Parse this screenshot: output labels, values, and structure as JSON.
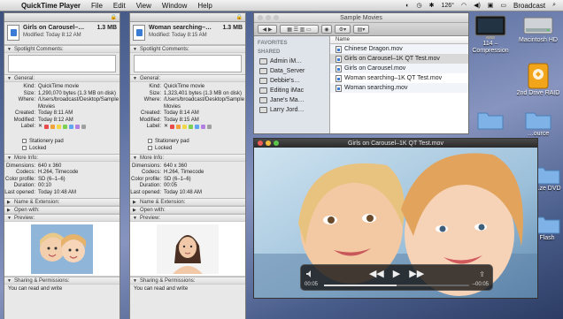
{
  "menubar": {
    "app_name": "QuickTime Player",
    "items": [
      "File",
      "Edit",
      "View",
      "Window",
      "Help"
    ],
    "temperature": "126°",
    "user": "Broadcast"
  },
  "info_windows": [
    {
      "title": "Girls on Carousel–…",
      "size": "1.3 MB",
      "modified": "Modified: Today 8:12 AM",
      "spotlight": "Spotlight Comments:",
      "general": "General:",
      "kind": "QuickTime movie",
      "size_detail": "1,290,070 bytes (1.3 MB on disk)",
      "where": "/Users/broadcast/Desktop/Sample Movies",
      "created": "Today 8:11 AM",
      "modified_detail": "Today 8:12 AM",
      "label": "Label:",
      "stationery": "Stationery pad",
      "locked": "Locked",
      "more_info": "More Info:",
      "dimensions": "640 x 360",
      "codecs": "H.264, Timecode",
      "color_profile": "SD (6–1–6)",
      "duration": "00:10",
      "last_opened": "Today 10:48 AM",
      "name_ext": "Name & Extension:",
      "open_with": "Open with:",
      "preview": "Preview:",
      "sharing": "Sharing & Permissions:",
      "sharing_text": "You can read and write"
    },
    {
      "title": "Woman searching–…",
      "size": "1.3 MB",
      "modified": "Modified: Today 8:15 AM",
      "spotlight": "Spotlight Comments:",
      "general": "General:",
      "kind": "QuickTime movie",
      "size_detail": "1,323,401 bytes (1.3 MB on disk)",
      "where": "/Users/broadcast/Desktop/Sample Movies",
      "created": "Today 8:14 AM",
      "modified_detail": "Today 8:15 AM",
      "label": "Label:",
      "stationery": "Stationery pad",
      "locked": "Locked",
      "more_info": "More Info:",
      "dimensions": "640 x 360",
      "codecs": "H.264, Timecode",
      "color_profile": "SD (6–1–6)",
      "duration": "00:05",
      "last_opened": "Today 10:48 AM",
      "name_ext": "Name & Extension:",
      "open_with": "Open with:",
      "preview": "Preview:",
      "sharing": "Sharing & Permissions:",
      "sharing_text": "You can read and write"
    }
  ],
  "kv_labels": {
    "kind": "Kind:",
    "size": "Size:",
    "where": "Where:",
    "created": "Created:",
    "modified": "Modified:",
    "dimensions": "Dimensions:",
    "codecs": "Codecs:",
    "color_profile": "Color profile:",
    "duration": "Duration:",
    "last_opened": "Last opened:"
  },
  "label_colors": [
    "#e94b4b",
    "#f2a23a",
    "#f1d84b",
    "#7ccf53",
    "#5fa5ef",
    "#b281e0",
    "#a0a0a0"
  ],
  "finder": {
    "title": "Sample Movies",
    "favorites_header": "FAVORITES",
    "shared_header": "SHARED",
    "shared_items": [
      "Admin iM…",
      "Data_Server",
      "Debbie's…",
      "Editing iMac",
      "Jane's Ma…",
      "Larry Jord…"
    ],
    "column_name": "Name",
    "files": [
      {
        "name": "Chinese Dragon.mov",
        "selected": false
      },
      {
        "name": "Girls on Carousel–1K QT Test.mov",
        "selected": true
      },
      {
        "name": "Girls on Carousel.mov",
        "selected": false
      },
      {
        "name": "Woman searching–1K QT Test.mov",
        "selected": false
      },
      {
        "name": "Woman searching.mov",
        "selected": false
      }
    ]
  },
  "desktop_icons": [
    {
      "label": "114 – Compression"
    },
    {
      "label": "Macintosh HD"
    },
    {
      "label": "2nd Drive RAID"
    },
    {
      "label": "…ze DVD"
    },
    {
      "label": "Flash"
    },
    {
      "label": "…ource"
    }
  ],
  "player": {
    "title": "Girls on Carousel–1K QT Test.mov",
    "current_time": "00:05",
    "remaining_time": "–00:05",
    "progress": 0.5
  }
}
